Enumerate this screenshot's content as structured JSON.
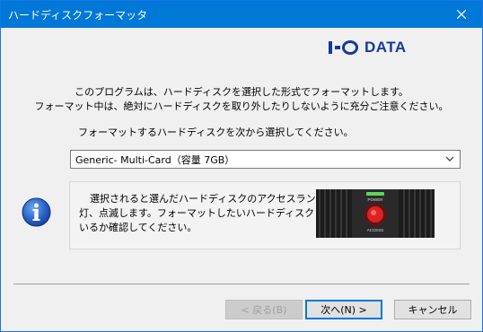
{
  "window": {
    "title": "ハードディスクフォーマッタ"
  },
  "brand": {
    "logo_text": "DATA",
    "logo_mark": "I-O",
    "color": "#153a9b"
  },
  "intro": {
    "line1": "このプログラムは、ハードディスクを選択した形式でフォーマットします。",
    "line2": "フォーマット中は、絶対にハードディスクを取り外したりしないように充分ご注意ください。"
  },
  "selection": {
    "label": "フォーマットするハードディスクを次から選択してください。",
    "selected": "Generic- Multi-Card（容量 7GB）"
  },
  "info": {
    "icon": "info-icon",
    "line1": "選択されると選んだハードディスクのアクセスランプが点",
    "line2": "灯、点滅します。フォーマットしたいハードディスクと合って",
    "line3": "いるか確認してください。",
    "image_labels": {
      "power": "POWER",
      "access": "ACCESS"
    }
  },
  "buttons": {
    "back": "< 戻る(B)",
    "next": "次へ(N) >",
    "cancel": "キャンセル"
  },
  "colors": {
    "titlebar": "#0078d7",
    "accent": "#0078d7"
  }
}
